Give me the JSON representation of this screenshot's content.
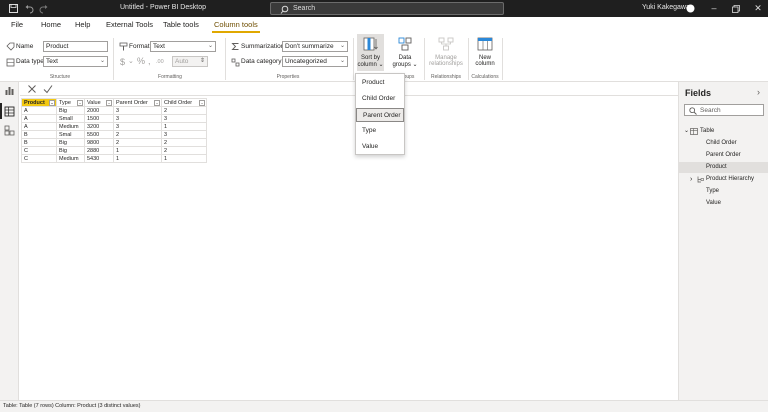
{
  "titlebar": {
    "title": "Untitled - Power BI Desktop",
    "search_label": "Search",
    "user": "Yuki Kakegawa",
    "icons": [
      "save-icon",
      "undo-icon",
      "redo-icon"
    ]
  },
  "menu": {
    "items": [
      "File",
      "Home",
      "Help",
      "External Tools",
      "Table tools",
      "Column tools"
    ]
  },
  "ribbon": {
    "structure": {
      "name_label": "Name",
      "name_value": "Product",
      "datatype_label": "Data type",
      "datatype_value": "Text",
      "group_label": "Structure"
    },
    "formatting": {
      "format_label": "Format",
      "format_value": "Text",
      "currency_symbol": "$",
      "percent_symbol": "%",
      "comma_symbol": ",",
      "decimals_symbol": ".00",
      "auto_value": "Auto",
      "group_label": "Formatting"
    },
    "properties": {
      "summarization_label": "Summarization",
      "summarization_value": "Don't summarize",
      "category_label": "Data category",
      "category_value": "Uncategorized",
      "group_label": "Properties"
    },
    "sort": {
      "line1": "Sort by",
      "line2": "column"
    },
    "groups": {
      "line1": "Data",
      "line2": "groups",
      "group_label_partial": "oups"
    },
    "relationships": {
      "line1": "Manage",
      "line2": "relationships",
      "group_label": "Relationships"
    },
    "calculations": {
      "line1": "New",
      "line2": "column",
      "group_label": "Calculations"
    }
  },
  "sort_menu": {
    "items": [
      "Product",
      "Child Order",
      "Parent Order",
      "Type",
      "Value"
    ],
    "selected": "Parent Order"
  },
  "grid": {
    "columns": [
      "Product",
      "Type",
      "Value",
      "Parent Order",
      "Child Order"
    ],
    "rows": [
      [
        "A",
        "Big",
        "2000",
        "3",
        "2"
      ],
      [
        "A",
        "Small",
        "1500",
        "3",
        "3"
      ],
      [
        "A",
        "Medium",
        "3200",
        "3",
        "1"
      ],
      [
        "B",
        "Smal",
        "5500",
        "2",
        "3"
      ],
      [
        "B",
        "Big",
        "9800",
        "2",
        "2"
      ],
      [
        "C",
        "Big",
        "2880",
        "1",
        "2"
      ],
      [
        "C",
        "Medium",
        "5430",
        "1",
        "1"
      ]
    ]
  },
  "fields_pane": {
    "title": "Fields",
    "search_placeholder": "Search",
    "table_name": "Table",
    "fields": [
      "Child Order",
      "Parent Order",
      "Product",
      "Product Hierarchy",
      "Type",
      "Value"
    ],
    "selected": "Product"
  },
  "status": {
    "text": "Table: Table (7 rows) Column: Product (3 distinct values)"
  },
  "colors": {
    "accent": "#f2c811",
    "titlebar": "#1f1f1f"
  }
}
